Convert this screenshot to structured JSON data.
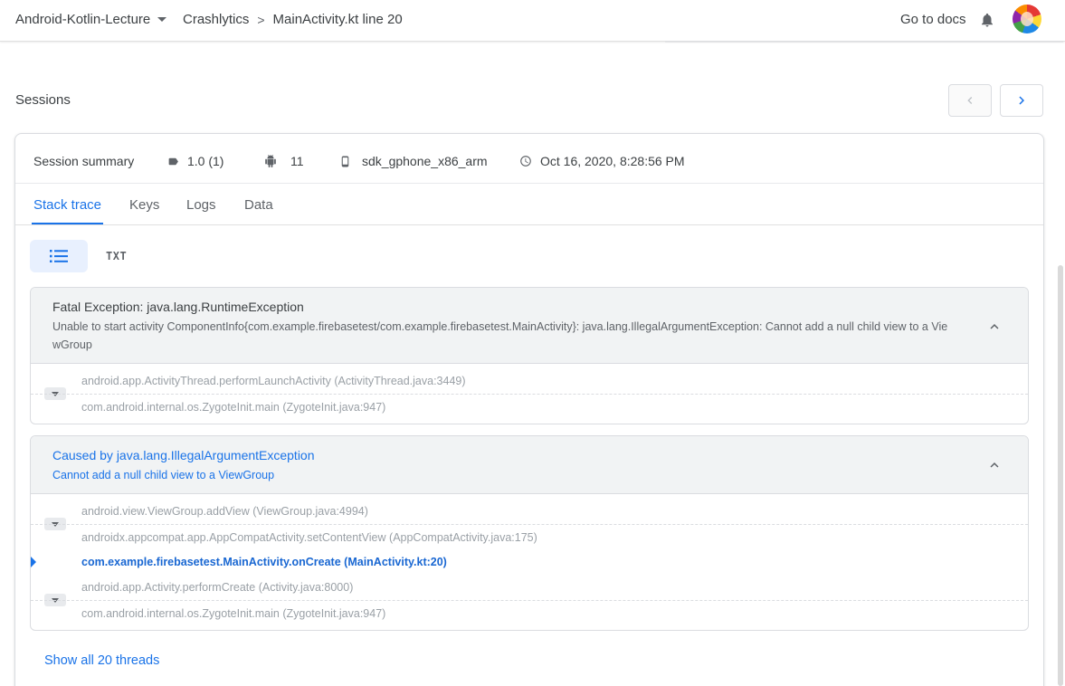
{
  "topbar": {
    "project": "Android-Kotlin-Lecture",
    "breadcrumb": [
      "Crashlytics",
      "MainActivity.kt line 20"
    ],
    "breadcrumb_sep": ">",
    "go_to_docs": "Go to docs"
  },
  "sessions": {
    "title": "Sessions"
  },
  "summary": {
    "label": "Session summary",
    "version": "1.0 (1)",
    "android_api": "11",
    "device": "sdk_gphone_x86_arm",
    "timestamp": "Oct 16, 2020, 8:28:56 PM"
  },
  "tabs": [
    {
      "label": "Stack trace",
      "active": true
    },
    {
      "label": "Keys",
      "active": false
    },
    {
      "label": "Logs",
      "active": false
    },
    {
      "label": "Data",
      "active": false
    }
  ],
  "view_toggle": {
    "txt_label": "TXT"
  },
  "exceptions": [
    {
      "title": "Fatal Exception: java.lang.RuntimeException",
      "message": "Unable to start activity ComponentInfo{com.example.firebasetest/com.example.firebasetest.MainActivity}: java.lang.IllegalArgumentException: Cannot add a null child view to a ViewGroup",
      "frames": [
        {
          "method": "android.app.ActivityThread.performLaunchActivity",
          "file": "(ActivityThread.java:3449)"
        },
        {
          "method": "com.android.internal.os.ZygoteInit.main",
          "file": "(ZygoteInit.java:947)"
        }
      ]
    },
    {
      "title": "Caused by java.lang.IllegalArgumentException",
      "message": "Cannot add a null child view to a ViewGroup",
      "frames": [
        {
          "method": "android.view.ViewGroup.addView",
          "file": "(ViewGroup.java:4994)"
        },
        {
          "method": "androidx.appcompat.app.AppCompatActivity.setContentView",
          "file": "(AppCompatActivity.java:175)"
        },
        {
          "method": "com.example.firebasetest.MainActivity.onCreate",
          "file": "(MainActivity.kt:20)"
        },
        {
          "method": "android.app.Activity.performCreate",
          "file": "(Activity.java:8000)"
        },
        {
          "method": "com.android.internal.os.ZygoteInit.main",
          "file": "(ZygoteInit.java:947)"
        }
      ]
    }
  ],
  "show_all_threads": "Show all 20 threads",
  "colors": {
    "accent": "#1a73e8",
    "panel_header": "#f1f3f4",
    "text": "#3c4043",
    "muted": "#9aa0a6"
  }
}
